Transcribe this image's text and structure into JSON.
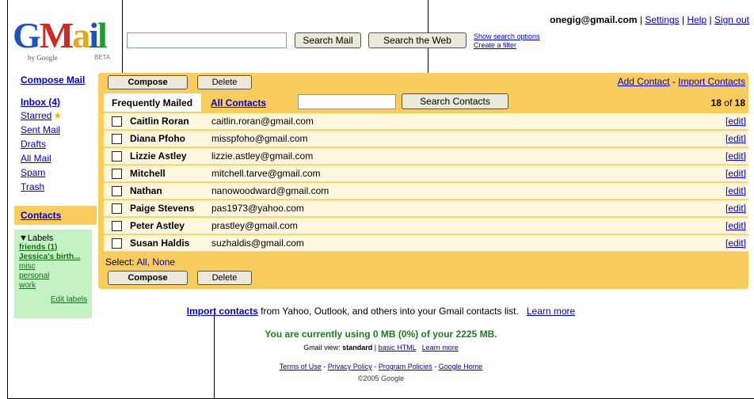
{
  "header": {
    "logo_bygoogle": "by Google",
    "logo_beta": "BETA",
    "search_mail": "Search Mail",
    "search_web": "Search the Web",
    "show_search_options": "Show search options",
    "create_filter": "Create a filter",
    "account_email": "onegig@gmail.com",
    "settings": "Settings",
    "help": "Help",
    "sign_out": "Sign out"
  },
  "sidebar": {
    "compose": "Compose Mail",
    "items": [
      "Inbox (4)",
      "Starred",
      "Sent Mail",
      "Drafts",
      "All Mail",
      "Spam",
      "Trash"
    ],
    "contacts": "Contacts",
    "labels_title": "Labels",
    "labels": [
      "friends (1)",
      "Jessica's birth...",
      "misc",
      "personal",
      "work"
    ],
    "edit_labels": "Edit labels"
  },
  "toolbar": {
    "compose": "Compose",
    "delete": "Delete",
    "add_contact": "Add Contact",
    "import_contacts": "Import Contacts"
  },
  "tabs": {
    "frequently_mailed": "Frequently Mailed",
    "all_contacts": "All Contacts",
    "search_contacts": "Search Contacts",
    "count_bold": "18",
    "count_rest": "of",
    "count_total": "18"
  },
  "contacts": [
    {
      "name": "Caitlin Roran",
      "email": "caitlin.roran@gmail.com",
      "edit": "[edit]"
    },
    {
      "name": "Diana Pfoho",
      "email": "misspfoho@gmail.com",
      "edit": "[edit]"
    },
    {
      "name": "Lizzie Astley",
      "email": "lizzie.astley@gmail.com",
      "edit": "[edit]"
    },
    {
      "name": "Mitchell",
      "email": "mitchell.tarve@gmail.com",
      "edit": "[edit]"
    },
    {
      "name": "Nathan",
      "email": "nanowoodward@gmail.com",
      "edit": "[edit]"
    },
    {
      "name": "Paige Stevens",
      "email": "pas1973@yahoo.com",
      "edit": "[edit]"
    },
    {
      "name": "Peter Astley",
      "email": "prastley@gmail.com",
      "edit": "[edit]"
    },
    {
      "name": "Susan Haldis",
      "email": "suzhaldis@gmail.com",
      "edit": "[edit]"
    }
  ],
  "select": {
    "label": "Select:",
    "all": "All",
    "none": "None"
  },
  "footer": {
    "import_link": "Import contacts",
    "import_text": "from Yahoo, Outlook, and others into your Gmail contacts list.",
    "learn_more": "Learn more",
    "usage": "You are currently using 0 MB (0%) of your 2225 MB.",
    "view_label": "Gmail view:",
    "view_standard": "standard",
    "basic_html": "basic HTML",
    "learn_more2": "Learn more",
    "terms": "Terms of Use",
    "privacy": "Privacy Policy",
    "program": "Program Policies",
    "google_home": "Google Home",
    "copyright": "©2005 Google"
  },
  "colors": {
    "panel": "#f9cc5e",
    "row": "#fff8de",
    "labels_bg": "#c4f2c4",
    "link": "#0000cc",
    "usage_text": "#1e7a1e"
  }
}
